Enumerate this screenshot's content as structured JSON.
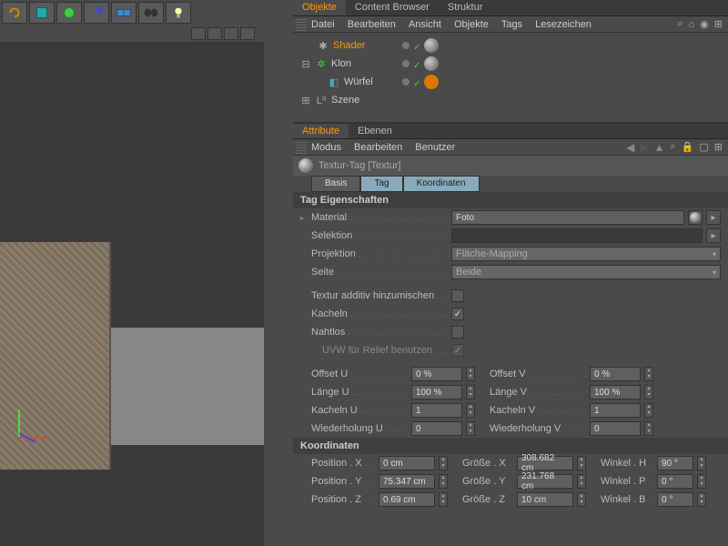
{
  "toolbar_icons": [
    "undo",
    "cube",
    "gear",
    "quarter",
    "plane",
    "camera",
    "light"
  ],
  "panel_tabs": {
    "objects": "Objekte",
    "content": "Content Browser",
    "structure": "Struktur"
  },
  "obj_menu": {
    "file": "Datei",
    "edit": "Bearbeiten",
    "view": "Ansicht",
    "objects": "Objekte",
    "tags": "Tags",
    "bookmarks": "Lesezeichen"
  },
  "tree": {
    "shader": "Shader",
    "klon": "Klon",
    "wurfel": "Würfel",
    "szene": "Szene"
  },
  "attr_tabs": {
    "attribute": "Attribute",
    "layers": "Ebenen"
  },
  "attr_menu": {
    "mode": "Modus",
    "edit": "Bearbeiten",
    "user": "Benutzer"
  },
  "attr_title": "Textur-Tag [Textur]",
  "sub_tabs": {
    "basis": "Basis",
    "tag": "Tag",
    "coord": "Koordinaten"
  },
  "sections": {
    "tag_props": "Tag Eigenschaften",
    "coords": "Koordinaten"
  },
  "props": {
    "material": "Material",
    "material_val": "Foto",
    "selektion": "Selektion",
    "selektion_val": "",
    "projektion": "Projektion",
    "projektion_val": "Fläche-Mapping",
    "seite": "Seite",
    "seite_val": "Beide",
    "textur_add": "Textur additiv hinzumischen",
    "kacheln": "Kacheln",
    "nahtlos": "Nahtlos",
    "uvw_relief": "UVW für Relief benutzen",
    "offset_u": "Offset U",
    "offset_u_val": "0 %",
    "offset_v": "Offset V",
    "offset_v_val": "0 %",
    "lange_u": "Länge U",
    "lange_u_val": "100 %",
    "lange_v": "Länge V",
    "lange_v_val": "100 %",
    "kacheln_u": "Kacheln U",
    "kacheln_u_val": "1",
    "kacheln_v": "Kacheln V",
    "kacheln_v_val": "1",
    "wieder_u": "Wiederholung U",
    "wieder_u_val": "0",
    "wieder_v": "Wiederholung V",
    "wieder_v_val": "0",
    "pos_x": "Position . X",
    "pos_x_val": "0 cm",
    "pos_y": "Position . Y",
    "pos_y_val": "75.347 cm",
    "pos_z": "Position . Z",
    "pos_z_val": "0.69 cm",
    "gr_x": "Größe . X",
    "gr_x_val": "308.682 cm",
    "gr_y": "Größe . Y",
    "gr_y_val": "231.768 cm",
    "gr_z": "Größe . Z",
    "gr_z_val": "10 cm",
    "w_h": "Winkel . H",
    "w_h_val": "90 °",
    "w_p": "Winkel . P",
    "w_p_val": "0 °",
    "w_b": "Winkel . B",
    "w_b_val": "0 °"
  }
}
